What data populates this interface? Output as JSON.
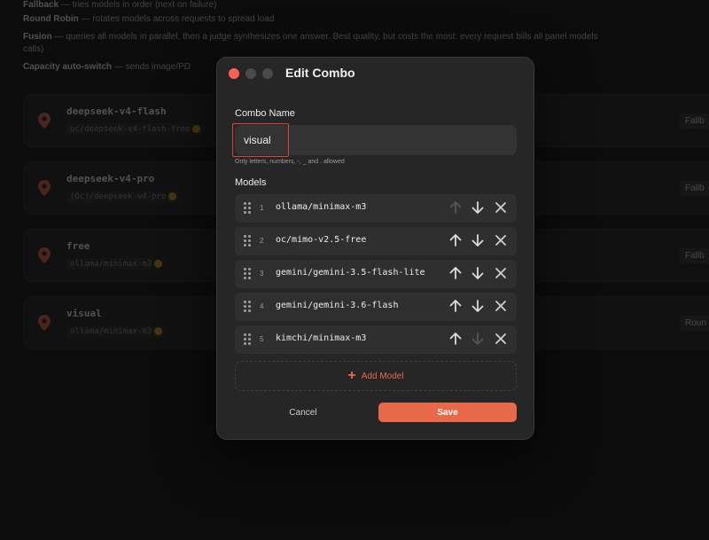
{
  "background": {
    "strategy_lines": [
      {
        "term": "Fallback",
        "desc": " — tries models in order (next on failure)"
      },
      {
        "term": "Round Robin",
        "desc": " — rotates models across requests to spread load"
      },
      {
        "term": "Fusion",
        "desc": " — queries all models in parallel, then a judge synthesizes one answer. Best quality, but costs the most: every request bills all panel models"
      },
      {
        "term": "",
        "desc": "calls)"
      },
      {
        "term": "Capacity auto-switch",
        "desc": " — sends image/PD"
      }
    ],
    "combos": [
      {
        "name": "deepseek-v4-flash",
        "sub": "oc/deepseek-v4-flash-free",
        "strategy": "Fallb"
      },
      {
        "name": "deepseek-v4-pro",
        "sub": "(Oc)/deepseek-v4-pro",
        "strategy": "Fallb"
      },
      {
        "name": "free",
        "sub": "ollama/minimax-m3",
        "strategy": "Fallb"
      },
      {
        "name": "visual",
        "sub": "ollama/minimax-m3",
        "strategy": "Roun"
      }
    ]
  },
  "modal": {
    "title": "Edit Combo",
    "name_label": "Combo Name",
    "name_value": "visual",
    "name_hint": "Only letters, numbers, -, _ and . allowed",
    "models_label": "Models",
    "models": [
      {
        "index": "1",
        "name": "ollama/minimax-m3",
        "up_enabled": false,
        "down_enabled": true
      },
      {
        "index": "2",
        "name": "oc/mimo-v2.5-free",
        "up_enabled": true,
        "down_enabled": true
      },
      {
        "index": "3",
        "name": "gemini/gemini-3.5-flash-lite",
        "up_enabled": true,
        "down_enabled": true
      },
      {
        "index": "4",
        "name": "gemini/gemini-3.6-flash",
        "up_enabled": true,
        "down_enabled": true
      },
      {
        "index": "5",
        "name": "kimchi/minimax-m3",
        "up_enabled": true,
        "down_enabled": false
      }
    ],
    "add_model_label": "Add Model",
    "cancel_label": "Cancel",
    "save_label": "Save"
  },
  "colors": {
    "accent": "#e8684a",
    "close": "#ff5f57",
    "highlight": "#e0413b"
  }
}
